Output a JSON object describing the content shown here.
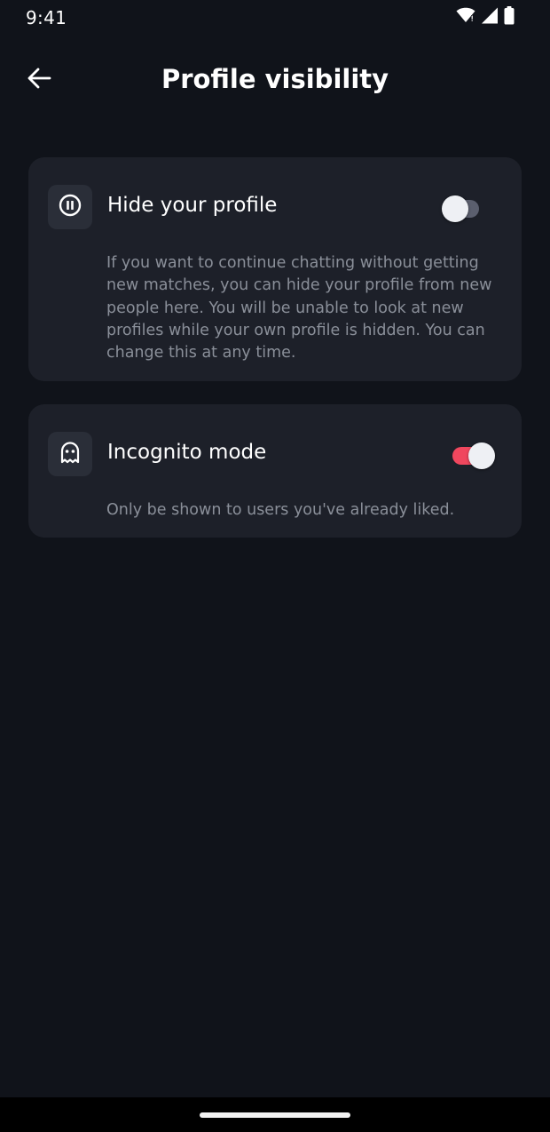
{
  "status_bar": {
    "time": "9:41",
    "icons": [
      "wifi-icon",
      "signal-icon",
      "battery-icon"
    ]
  },
  "header": {
    "title": "Profile visibility",
    "back_icon": "arrow-left-icon"
  },
  "settings": [
    {
      "icon": "pause-circle-icon",
      "title": "Hide your profile",
      "description": "If you want to continue chatting without getting new matches, you can hide your profile from new people here. You will be unable to look at new profiles while your own profile is hidden. You can change this at any time.",
      "enabled": false
    },
    {
      "icon": "ghost-icon",
      "title": "Incognito mode",
      "description": "Only be shown to users you've already liked.",
      "enabled": true
    }
  ],
  "colors": {
    "background": "#10131a",
    "card": "#1d2029",
    "icon_box": "#2a2e38",
    "toggle_on": "#f0475e",
    "toggle_off": "#5b5f6e",
    "muted_text": "#8a8f99"
  }
}
